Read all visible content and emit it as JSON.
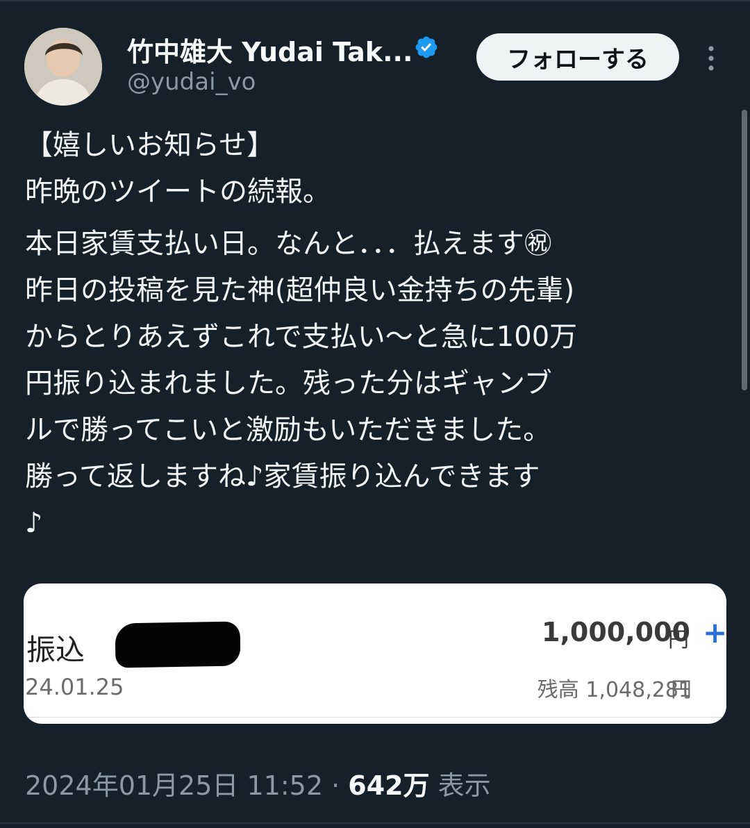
{
  "author": {
    "display_name": "竹中雄大 Yudai Tak...",
    "handle": "@yudai_vo",
    "verified_badge_icon": "verified-badge-icon",
    "avatar_icon": "profile-avatar"
  },
  "actions": {
    "follow_label": "フォローする",
    "more_icon": "more-vertical-icon"
  },
  "tweet": {
    "lines": [
      "【嬉しいお知らせ】\n昨晩のツイートの続報。",
      "本日家賃支払い日。なんと．．．払えます㊗\n昨日の投稿を見た神(超仲良い金持ちの先輩)\nからとりあえずこれで支払い〜と急に100万\n円振り込まれました。残った分はギャンブ\nルで勝ってこいと激励もいただきました。\n勝って返しますね♪家賃振り込んできます\n♪"
    ]
  },
  "media": {
    "transaction_type": "振込",
    "date": "24.01.25",
    "amount": "1,000,000",
    "amount_unit": "円",
    "plus_sign": "+",
    "balance_label": "残高 1,048,281",
    "balance_unit": "円"
  },
  "meta": {
    "timestamp": "2024年01月25日 11:52",
    "separator": " · ",
    "views_count": "642万",
    "views_label": " 表示"
  },
  "colors": {
    "background": "#15202b",
    "text": "#f2f4f5",
    "muted": "#8b98a5",
    "verified_blue": "#1d9bf0",
    "plus_blue": "#2a6fd4"
  }
}
